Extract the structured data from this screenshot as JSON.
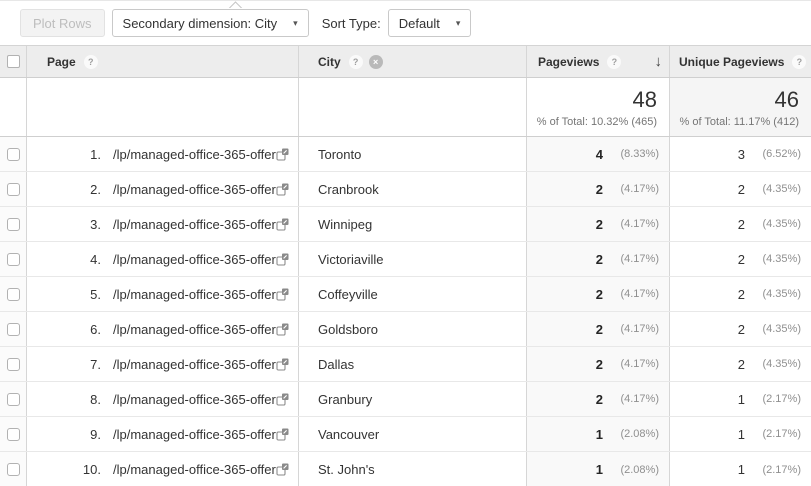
{
  "toolbar": {
    "plot_rows_label": "Plot Rows",
    "secondary_dimension_label": "Secondary dimension: City",
    "sort_type_label": "Sort Type:",
    "sort_type_value": "Default"
  },
  "icons": {
    "help_glyph": "?",
    "close_glyph": "×",
    "sort_desc_glyph": "↓",
    "caret_glyph": "▾"
  },
  "table": {
    "columns": {
      "page": "Page",
      "city": "City",
      "pageviews": "Pageviews",
      "unique_pageviews": "Unique Pageviews"
    },
    "totals": {
      "pageviews_value": "48",
      "pageviews_pct": "% of Total: 10.32% (465)",
      "unique_value": "46",
      "unique_pct": "% of Total: 11.17% (412)"
    },
    "rows": [
      {
        "num": "1.",
        "page": "/lp/managed-office-365-offer/",
        "city": "Toronto",
        "pageviews": "4",
        "pageviews_pct": "(8.33%)",
        "unique": "3",
        "unique_pct": "(6.52%)"
      },
      {
        "num": "2.",
        "page": "/lp/managed-office-365-offer/",
        "city": "Cranbrook",
        "pageviews": "2",
        "pageviews_pct": "(4.17%)",
        "unique": "2",
        "unique_pct": "(4.35%)"
      },
      {
        "num": "3.",
        "page": "/lp/managed-office-365-offer/",
        "city": "Winnipeg",
        "pageviews": "2",
        "pageviews_pct": "(4.17%)",
        "unique": "2",
        "unique_pct": "(4.35%)"
      },
      {
        "num": "4.",
        "page": "/lp/managed-office-365-offer/",
        "city": "Victoriaville",
        "pageviews": "2",
        "pageviews_pct": "(4.17%)",
        "unique": "2",
        "unique_pct": "(4.35%)"
      },
      {
        "num": "5.",
        "page": "/lp/managed-office-365-offer/",
        "city": "Coffeyville",
        "pageviews": "2",
        "pageviews_pct": "(4.17%)",
        "unique": "2",
        "unique_pct": "(4.35%)"
      },
      {
        "num": "6.",
        "page": "/lp/managed-office-365-offer/",
        "city": "Goldsboro",
        "pageviews": "2",
        "pageviews_pct": "(4.17%)",
        "unique": "2",
        "unique_pct": "(4.35%)"
      },
      {
        "num": "7.",
        "page": "/lp/managed-office-365-offer/",
        "city": "Dallas",
        "pageviews": "2",
        "pageviews_pct": "(4.17%)",
        "unique": "2",
        "unique_pct": "(4.35%)"
      },
      {
        "num": "8.",
        "page": "/lp/managed-office-365-offer/",
        "city": "Granbury",
        "pageviews": "2",
        "pageviews_pct": "(4.17%)",
        "unique": "1",
        "unique_pct": "(2.17%)"
      },
      {
        "num": "9.",
        "page": "/lp/managed-office-365-offer/",
        "city": "Vancouver",
        "pageviews": "1",
        "pageviews_pct": "(2.08%)",
        "unique": "1",
        "unique_pct": "(2.17%)"
      },
      {
        "num": "10.",
        "page": "/lp/managed-office-365-offer/",
        "city": "St. John's",
        "pageviews": "1",
        "pageviews_pct": "(2.08%)",
        "unique": "1",
        "unique_pct": "(2.17%)"
      }
    ]
  },
  "colors": {
    "header_bg": "#ededed",
    "sorted_column_bg": "#f9f9f9",
    "summary_unique_bg": "#f5f5f5",
    "border": "#d6d6d6",
    "row_border": "#e8e8e8",
    "pct_text": "#8f8f8f",
    "disabled_bg": "#f3f3f3",
    "disabled_text": "#bdbdbd",
    "top_border": "#e7e7e7"
  }
}
